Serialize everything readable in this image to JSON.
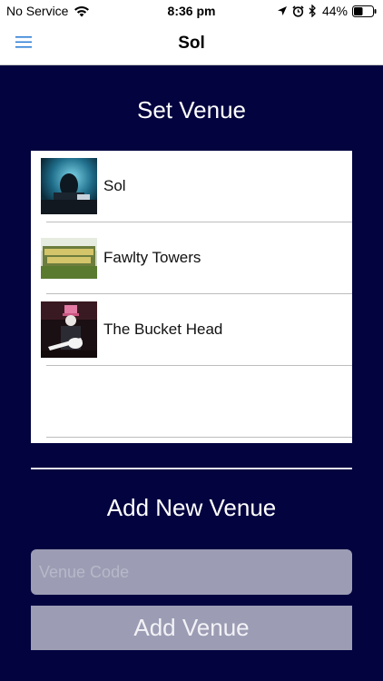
{
  "status_bar": {
    "carrier": "No Service",
    "time": "8:36 pm",
    "battery_percent": "44%"
  },
  "nav": {
    "title": "Sol"
  },
  "set_venue": {
    "title": "Set Venue",
    "venues": [
      {
        "name": "Sol",
        "thumb": "person-at-laptop-thumbnail"
      },
      {
        "name": "Fawlty Towers",
        "thumb": "fawlty-towers-sign-thumbnail"
      },
      {
        "name": "The Bucket Head",
        "thumb": "guitarist-bucket-hat-thumbnail"
      }
    ]
  },
  "add_venue": {
    "title": "Add New Venue",
    "code_placeholder": "Venue Code",
    "button_label": "Add Venue"
  },
  "colors": {
    "background": "#02033f",
    "control": "#9c9cb4",
    "accent": "#2f7fd6"
  }
}
